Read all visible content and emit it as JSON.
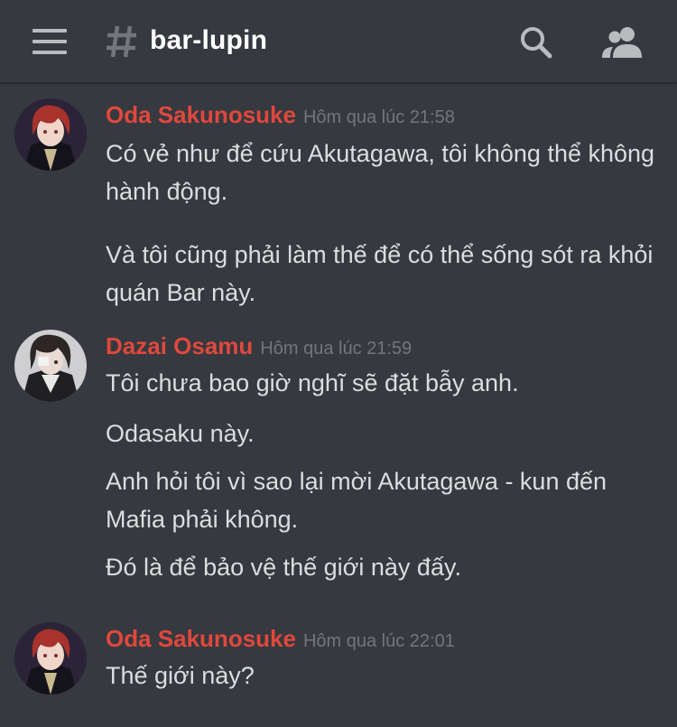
{
  "header": {
    "channel_name": "bar-lupin",
    "icons": [
      "menu-icon",
      "hash-icon",
      "search-icon",
      "members-icon"
    ]
  },
  "messages": [
    {
      "username": "Oda Sakunosuke",
      "timestamp": "Hôm qua lúc 21:58",
      "lines": [
        "Có vẻ như để cứu Akutagawa, tôi không thể không hành động.",
        "Và tôi cũng phải làm thế để có thể sống sót ra khỏi quán Bar này."
      ]
    },
    {
      "username": "Dazai Osamu",
      "timestamp": "Hôm qua lúc 21:59",
      "lines": [
        "Tôi chưa bao giờ nghĩ sẽ đặt bẫy anh.",
        "Odasaku này.",
        "Anh hỏi tôi vì sao lại mời Akutagawa - kun đến Mafia phải không.",
        "Đó là để bảo vệ thế giới này đấy."
      ]
    },
    {
      "username": "Oda Sakunosuke",
      "timestamp": "Hôm qua lúc 22:01",
      "lines": [
        "Thế giới này?"
      ]
    }
  ],
  "colors": {
    "background": "#36393f",
    "username": "#e0483d",
    "timestamp": "#72767d",
    "text": "#dcddde",
    "icon": "#b9bbbe"
  }
}
